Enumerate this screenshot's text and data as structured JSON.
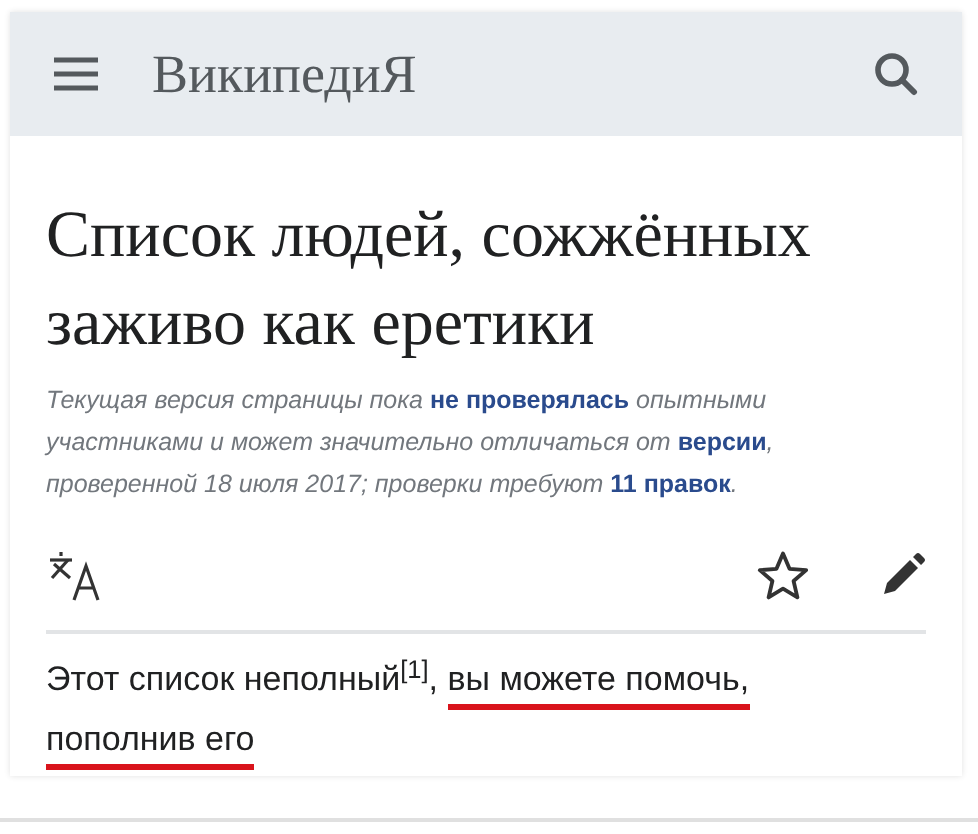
{
  "header": {
    "logo": "ВикипедиЯ"
  },
  "title": "Список людей, сожжённых заживо как еретики",
  "notice": [
    {
      "text": "Текущая версия страницы пока",
      "kind": "text"
    },
    {
      "text": "не проверялась",
      "kind": "link"
    },
    {
      "text": "опытными участниками и может значительно отличаться от",
      "kind": "text"
    },
    {
      "text": "версии",
      "kind": "link"
    },
    {
      "text": ", проверенной 18 июля 2017; проверки требуют",
      "kind": "text"
    },
    {
      "text": "11 правок",
      "kind": "link"
    },
    {
      "text": ".",
      "kind": "text"
    }
  ],
  "intro": [
    {
      "text": "Этот список неполный$^{[1]}$, ",
      "underlined": false
    },
    {
      "text": "вы можете помочь, ",
      "underlined": true
    },
    {
      "text": "пополнив его",
      "underlined": true
    }
  ]
}
